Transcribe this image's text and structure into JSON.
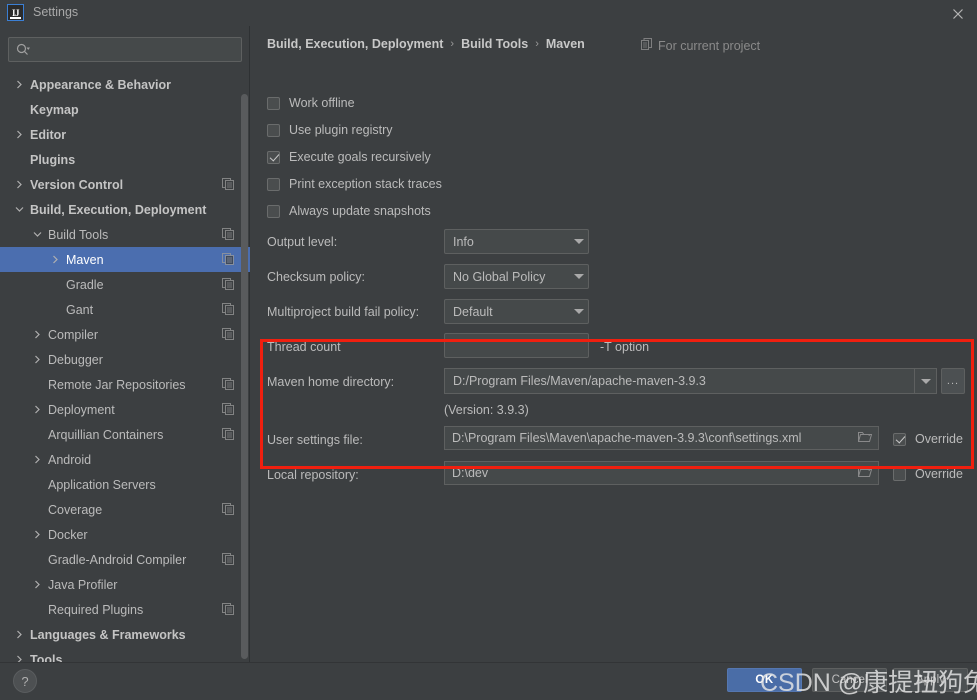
{
  "window": {
    "title": "Settings",
    "app_icon": "IJ",
    "close_icon": "close-icon"
  },
  "search": {
    "value": "",
    "placeholder": "",
    "icon": "search-icon"
  },
  "sidebar": {
    "items": [
      {
        "label": "Appearance & Behavior",
        "indent": 0,
        "chevron": "right",
        "bold": true,
        "copy": false,
        "selected": false
      },
      {
        "label": "Keymap",
        "indent": 0,
        "chevron": "none",
        "bold": true,
        "copy": false,
        "selected": false
      },
      {
        "label": "Editor",
        "indent": 0,
        "chevron": "right",
        "bold": true,
        "copy": false,
        "selected": false
      },
      {
        "label": "Plugins",
        "indent": 0,
        "chevron": "none",
        "bold": true,
        "copy": false,
        "selected": false
      },
      {
        "label": "Version Control",
        "indent": 0,
        "chevron": "right",
        "bold": true,
        "copy": true,
        "selected": false
      },
      {
        "label": "Build, Execution, Deployment",
        "indent": 0,
        "chevron": "down",
        "bold": true,
        "copy": false,
        "selected": false
      },
      {
        "label": "Build Tools",
        "indent": 1,
        "chevron": "down",
        "bold": false,
        "copy": true,
        "selected": false
      },
      {
        "label": "Maven",
        "indent": 2,
        "chevron": "right",
        "bold": false,
        "copy": true,
        "selected": true
      },
      {
        "label": "Gradle",
        "indent": 2,
        "chevron": "none",
        "bold": false,
        "copy": true,
        "selected": false
      },
      {
        "label": "Gant",
        "indent": 2,
        "chevron": "none",
        "bold": false,
        "copy": true,
        "selected": false
      },
      {
        "label": "Compiler",
        "indent": 1,
        "chevron": "right",
        "bold": false,
        "copy": true,
        "selected": false
      },
      {
        "label": "Debugger",
        "indent": 1,
        "chevron": "right",
        "bold": false,
        "copy": false,
        "selected": false
      },
      {
        "label": "Remote Jar Repositories",
        "indent": 1,
        "chevron": "none",
        "bold": false,
        "copy": true,
        "selected": false
      },
      {
        "label": "Deployment",
        "indent": 1,
        "chevron": "right",
        "bold": false,
        "copy": true,
        "selected": false
      },
      {
        "label": "Arquillian Containers",
        "indent": 1,
        "chevron": "none",
        "bold": false,
        "copy": true,
        "selected": false
      },
      {
        "label": "Android",
        "indent": 1,
        "chevron": "right",
        "bold": false,
        "copy": false,
        "selected": false
      },
      {
        "label": "Application Servers",
        "indent": 1,
        "chevron": "none",
        "bold": false,
        "copy": false,
        "selected": false
      },
      {
        "label": "Coverage",
        "indent": 1,
        "chevron": "none",
        "bold": false,
        "copy": true,
        "selected": false
      },
      {
        "label": "Docker",
        "indent": 1,
        "chevron": "right",
        "bold": false,
        "copy": false,
        "selected": false
      },
      {
        "label": "Gradle-Android Compiler",
        "indent": 1,
        "chevron": "none",
        "bold": false,
        "copy": true,
        "selected": false
      },
      {
        "label": "Java Profiler",
        "indent": 1,
        "chevron": "right",
        "bold": false,
        "copy": false,
        "selected": false
      },
      {
        "label": "Required Plugins",
        "indent": 1,
        "chevron": "none",
        "bold": false,
        "copy": true,
        "selected": false
      },
      {
        "label": "Languages & Frameworks",
        "indent": 0,
        "chevron": "right",
        "bold": true,
        "copy": false,
        "selected": false
      },
      {
        "label": "Tools",
        "indent": 0,
        "chevron": "right",
        "bold": true,
        "copy": false,
        "selected": false
      }
    ]
  },
  "main": {
    "breadcrumb": {
      "part1": "Build, Execution, Deployment",
      "part2": "Build Tools",
      "part3": "Maven",
      "separator": "›"
    },
    "scope": {
      "icon": "project-scope-icon",
      "label": "For current project"
    },
    "checkboxes": [
      {
        "label": "Work offline",
        "checked": false
      },
      {
        "label": "Use plugin registry",
        "checked": false
      },
      {
        "label": "Execute goals recursively",
        "checked": true
      },
      {
        "label": "Print exception stack traces",
        "checked": false
      },
      {
        "label": "Always update snapshots",
        "checked": false
      }
    ],
    "output_level": {
      "label": "Output level:",
      "value": "Info"
    },
    "checksum_policy": {
      "label": "Checksum policy:",
      "value": "No Global Policy"
    },
    "multiproject_policy": {
      "label": "Multiproject build fail policy:",
      "value": "Default"
    },
    "thread_count": {
      "label": "Thread count",
      "value": "",
      "hint": "-T option"
    },
    "maven_home": {
      "label": "Maven home directory:",
      "value": "D:/Program Files/Maven/apache-maven-3.9.3",
      "browse_label": "...",
      "version_note": "(Version: 3.9.3)"
    },
    "user_settings": {
      "label": "User settings file:",
      "value": "D:\\Program Files\\Maven\\apache-maven-3.9.3\\conf\\settings.xml",
      "override_label": "Override",
      "override_checked": true
    },
    "local_repository": {
      "label": "Local repository:",
      "value": "D:\\dev",
      "override_label": "Override",
      "override_checked": false
    },
    "highlight_color": "#f01f0f"
  },
  "footer": {
    "help_label": "?",
    "ok_label": "OK",
    "cancel_label": "Cancel",
    "apply_label": "Apply"
  },
  "watermark": {
    "text": "CSDN @康提扭狗兔"
  }
}
